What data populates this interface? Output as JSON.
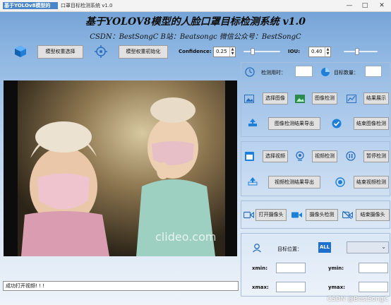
{
  "window": {
    "logo_text": "基于YOLOv8模型的",
    "title": "口罩目标检测系统 v1.0",
    "minimize": "—",
    "maximize": "□",
    "close": "✕"
  },
  "header": {
    "title": "基于YOLOV8模型的人脸口罩目标检测系统 v1.0",
    "subtitle": "CSDN：BestSongC   B站：Beatsongc   微信公众号：BestSongC"
  },
  "toolbar": {
    "select_weights": "模型权重选择",
    "init_weights": "模型权重初始化",
    "confidence_label": "Confidence:",
    "confidence_value": "0.25",
    "iou_label": "IOU:",
    "iou_value": "0.40",
    "confidence_slider": 0.25,
    "iou_slider": 0.4
  },
  "stats": {
    "time_label": "检测用时：",
    "count_label": "目标数量："
  },
  "image_section": {
    "select": "选择图像",
    "detect": "图像检测",
    "show": "结果展示",
    "export": "图像检测结果导出",
    "stop": "结束图像检测"
  },
  "video_section": {
    "select": "选择视频",
    "detect": "视频检测",
    "pause": "暂停检测",
    "export": "视频检测结果导出",
    "stop": "结束视频检测"
  },
  "camera_section": {
    "open": "打开摄像头",
    "detect": "摄像头检测",
    "stop": "结束摄像头"
  },
  "target": {
    "position_label": "目标位置：",
    "all_badge": "ALL",
    "xmin_label": "xmin:",
    "ymin_label": "ymin:",
    "xmax_label": "xmax:",
    "ymax_label": "ymax:"
  },
  "status": {
    "message": "成功打开视频! ! !"
  },
  "video": {
    "overlay_text": "clideo.com"
  },
  "watermark": "CSDN @BestSongC"
}
